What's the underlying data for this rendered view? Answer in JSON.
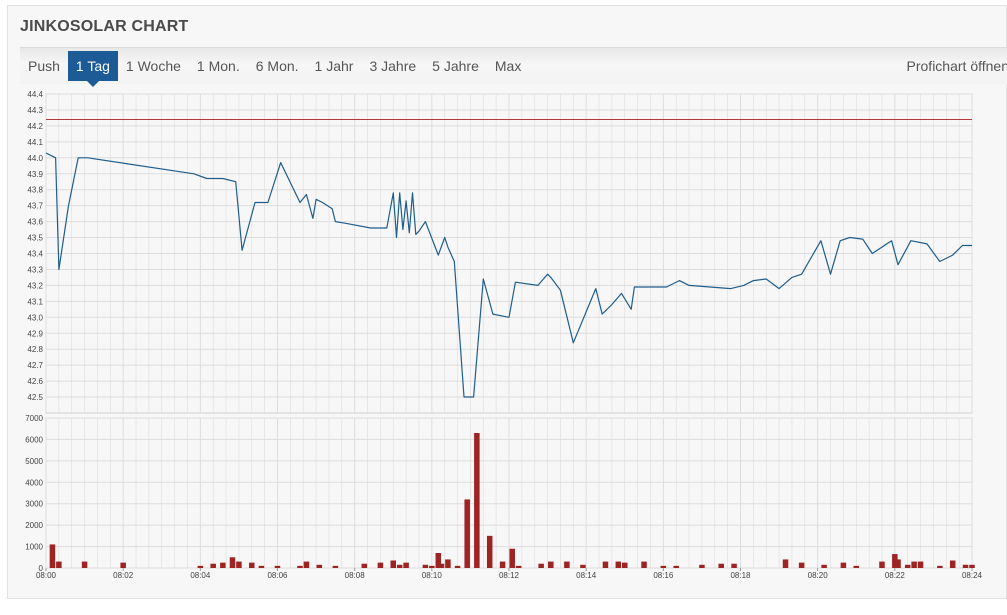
{
  "widget": {
    "title": "JINKOSOLAR CHART",
    "tabs": [
      {
        "label": "Push",
        "active": false
      },
      {
        "label": "1 Tag",
        "active": true
      },
      {
        "label": "1 Woche",
        "active": false
      },
      {
        "label": "1 Mon.",
        "active": false
      },
      {
        "label": "6 Mon.",
        "active": false
      },
      {
        "label": "1 Jahr",
        "active": false
      },
      {
        "label": "3 Jahre",
        "active": false
      },
      {
        "label": "5 Jahre",
        "active": false
      },
      {
        "label": "Max",
        "active": false
      }
    ],
    "profichart_label": "Profichart öffnen"
  },
  "colors": {
    "accent": "#1d5b96",
    "price_line": "#1f5d8c",
    "reference_line": "#b23a3a",
    "volume_bar": "#9e2323",
    "grid": "#dddddd",
    "plot_bg": "#f7f7f7"
  },
  "chart_data": [
    {
      "type": "line",
      "title": "",
      "xlabel": "",
      "ylabel": "",
      "xlim": [
        "08:00",
        "08:24"
      ],
      "ylim": [
        42.4,
        44.4
      ],
      "y_ticks": [
        "42.5",
        "42.6",
        "42.7",
        "42.8",
        "42.9",
        "43.0",
        "43.1",
        "43.2",
        "43.3",
        "43.4",
        "43.5",
        "43.6",
        "43.7",
        "43.8",
        "43.9",
        "44.0",
        "44.1",
        "44.2",
        "44.3",
        "44.4"
      ],
      "reference_line": {
        "y": 44.24
      },
      "grid": true,
      "series": [
        {
          "x": [
            "08:00:00",
            "08:00:15",
            "08:00:20",
            "08:00:35",
            "08:00:50",
            "08:01:05",
            "08:03:50",
            "08:04:10",
            "08:04:35",
            "08:04:55",
            "08:05:05",
            "08:05:25",
            "08:05:45",
            "08:06:05",
            "08:06:35",
            "08:06:45",
            "08:06:55",
            "08:07:00",
            "08:07:10",
            "08:07:25",
            "08:07:30",
            "08:07:45",
            "08:08:25",
            "08:08:50",
            "08:09:00",
            "08:09:05",
            "08:09:10",
            "08:09:15",
            "08:09:20",
            "08:09:25",
            "08:09:30",
            "08:09:35",
            "08:09:40",
            "08:09:50",
            "08:10:10",
            "08:10:20",
            "08:10:25",
            "08:10:35",
            "08:10:50",
            "08:11:05",
            "08:11:20",
            "08:11:35",
            "08:12:00",
            "08:12:10",
            "08:12:45",
            "08:13:00",
            "08:13:05",
            "08:13:20",
            "08:13:40",
            "08:14:15",
            "08:14:25",
            "08:14:40",
            "08:14:55",
            "08:15:10",
            "08:15:15",
            "08:16:05",
            "08:16:25",
            "08:16:40",
            "08:17:45",
            "08:18:05",
            "08:18:20",
            "08:18:40",
            "08:19:00",
            "08:19:20",
            "08:19:35",
            "08:20:05",
            "08:20:20",
            "08:20:35",
            "08:20:50",
            "08:21:10",
            "08:21:25",
            "08:21:55",
            "08:22:05",
            "08:22:25",
            "08:22:50",
            "08:23:10",
            "08:23:30",
            "08:23:45",
            "08:24:00"
          ],
          "values": [
            44.03,
            44.0,
            43.3,
            43.7,
            44.0,
            44.0,
            43.9,
            43.87,
            43.87,
            43.85,
            43.42,
            43.72,
            43.72,
            43.97,
            43.72,
            43.77,
            43.62,
            43.74,
            43.72,
            43.68,
            43.6,
            43.59,
            43.56,
            43.56,
            43.78,
            43.5,
            43.78,
            43.55,
            43.73,
            43.53,
            43.78,
            43.52,
            43.54,
            43.6,
            43.39,
            43.5,
            43.44,
            43.35,
            42.5,
            42.5,
            43.24,
            43.02,
            43.0,
            43.22,
            43.2,
            43.27,
            43.25,
            43.17,
            42.84,
            43.18,
            43.02,
            43.08,
            43.15,
            43.05,
            43.19,
            43.19,
            43.23,
            43.2,
            43.18,
            43.2,
            43.23,
            43.24,
            43.18,
            43.25,
            43.27,
            43.48,
            43.27,
            43.48,
            43.5,
            43.49,
            43.4,
            43.48,
            43.33,
            43.48,
            43.46,
            43.35,
            43.39,
            43.45,
            43.45
          ]
        }
      ]
    },
    {
      "type": "bar",
      "title": "",
      "xlabel": "",
      "ylabel": "",
      "ylim": [
        0,
        7000
      ],
      "y_ticks": [
        "0",
        "1000",
        "2000",
        "3000",
        "4000",
        "5000",
        "6000",
        "7000"
      ],
      "x_ticks": [
        "08:00",
        "08:02",
        "08:04",
        "08:06",
        "08:08",
        "08:10",
        "08:12",
        "08:14",
        "08:16",
        "08:18",
        "08:20",
        "08:22",
        "08:24"
      ],
      "grid": true,
      "x": [
        "08:00:10",
        "08:00:20",
        "08:01:00",
        "08:02:00",
        "08:04:00",
        "08:04:20",
        "08:04:35",
        "08:04:50",
        "08:05:00",
        "08:05:20",
        "08:05:35",
        "08:06:00",
        "08:06:35",
        "08:06:45",
        "08:07:05",
        "08:07:30",
        "08:08:15",
        "08:08:40",
        "08:09:00",
        "08:09:10",
        "08:09:20",
        "08:09:50",
        "08:10:00",
        "08:10:10",
        "08:10:15",
        "08:10:25",
        "08:10:40",
        "08:10:55",
        "08:11:10",
        "08:11:30",
        "08:11:50",
        "08:12:05",
        "08:12:15",
        "08:12:50",
        "08:13:05",
        "08:13:30",
        "08:13:55",
        "08:14:30",
        "08:14:50",
        "08:15:00",
        "08:15:30",
        "08:16:00",
        "08:16:20",
        "08:17:00",
        "08:17:30",
        "08:17:50",
        "08:19:10",
        "08:19:35",
        "08:20:10",
        "08:20:40",
        "08:21:00",
        "08:21:40",
        "08:22:00",
        "08:22:05",
        "08:22:20",
        "08:22:30",
        "08:22:40",
        "08:23:10",
        "08:23:30",
        "08:23:50",
        "08:24:00"
      ],
      "values": [
        1100,
        300,
        300,
        250,
        100,
        200,
        250,
        500,
        300,
        250,
        100,
        100,
        100,
        300,
        150,
        100,
        200,
        250,
        350,
        150,
        250,
        150,
        100,
        700,
        200,
        400,
        100,
        3200,
        6300,
        1500,
        300,
        900,
        100,
        200,
        300,
        300,
        150,
        300,
        300,
        250,
        300,
        100,
        100,
        150,
        200,
        200,
        400,
        250,
        150,
        250,
        100,
        300,
        650,
        400,
        150,
        300,
        300,
        100,
        350,
        150,
        150
      ]
    }
  ]
}
